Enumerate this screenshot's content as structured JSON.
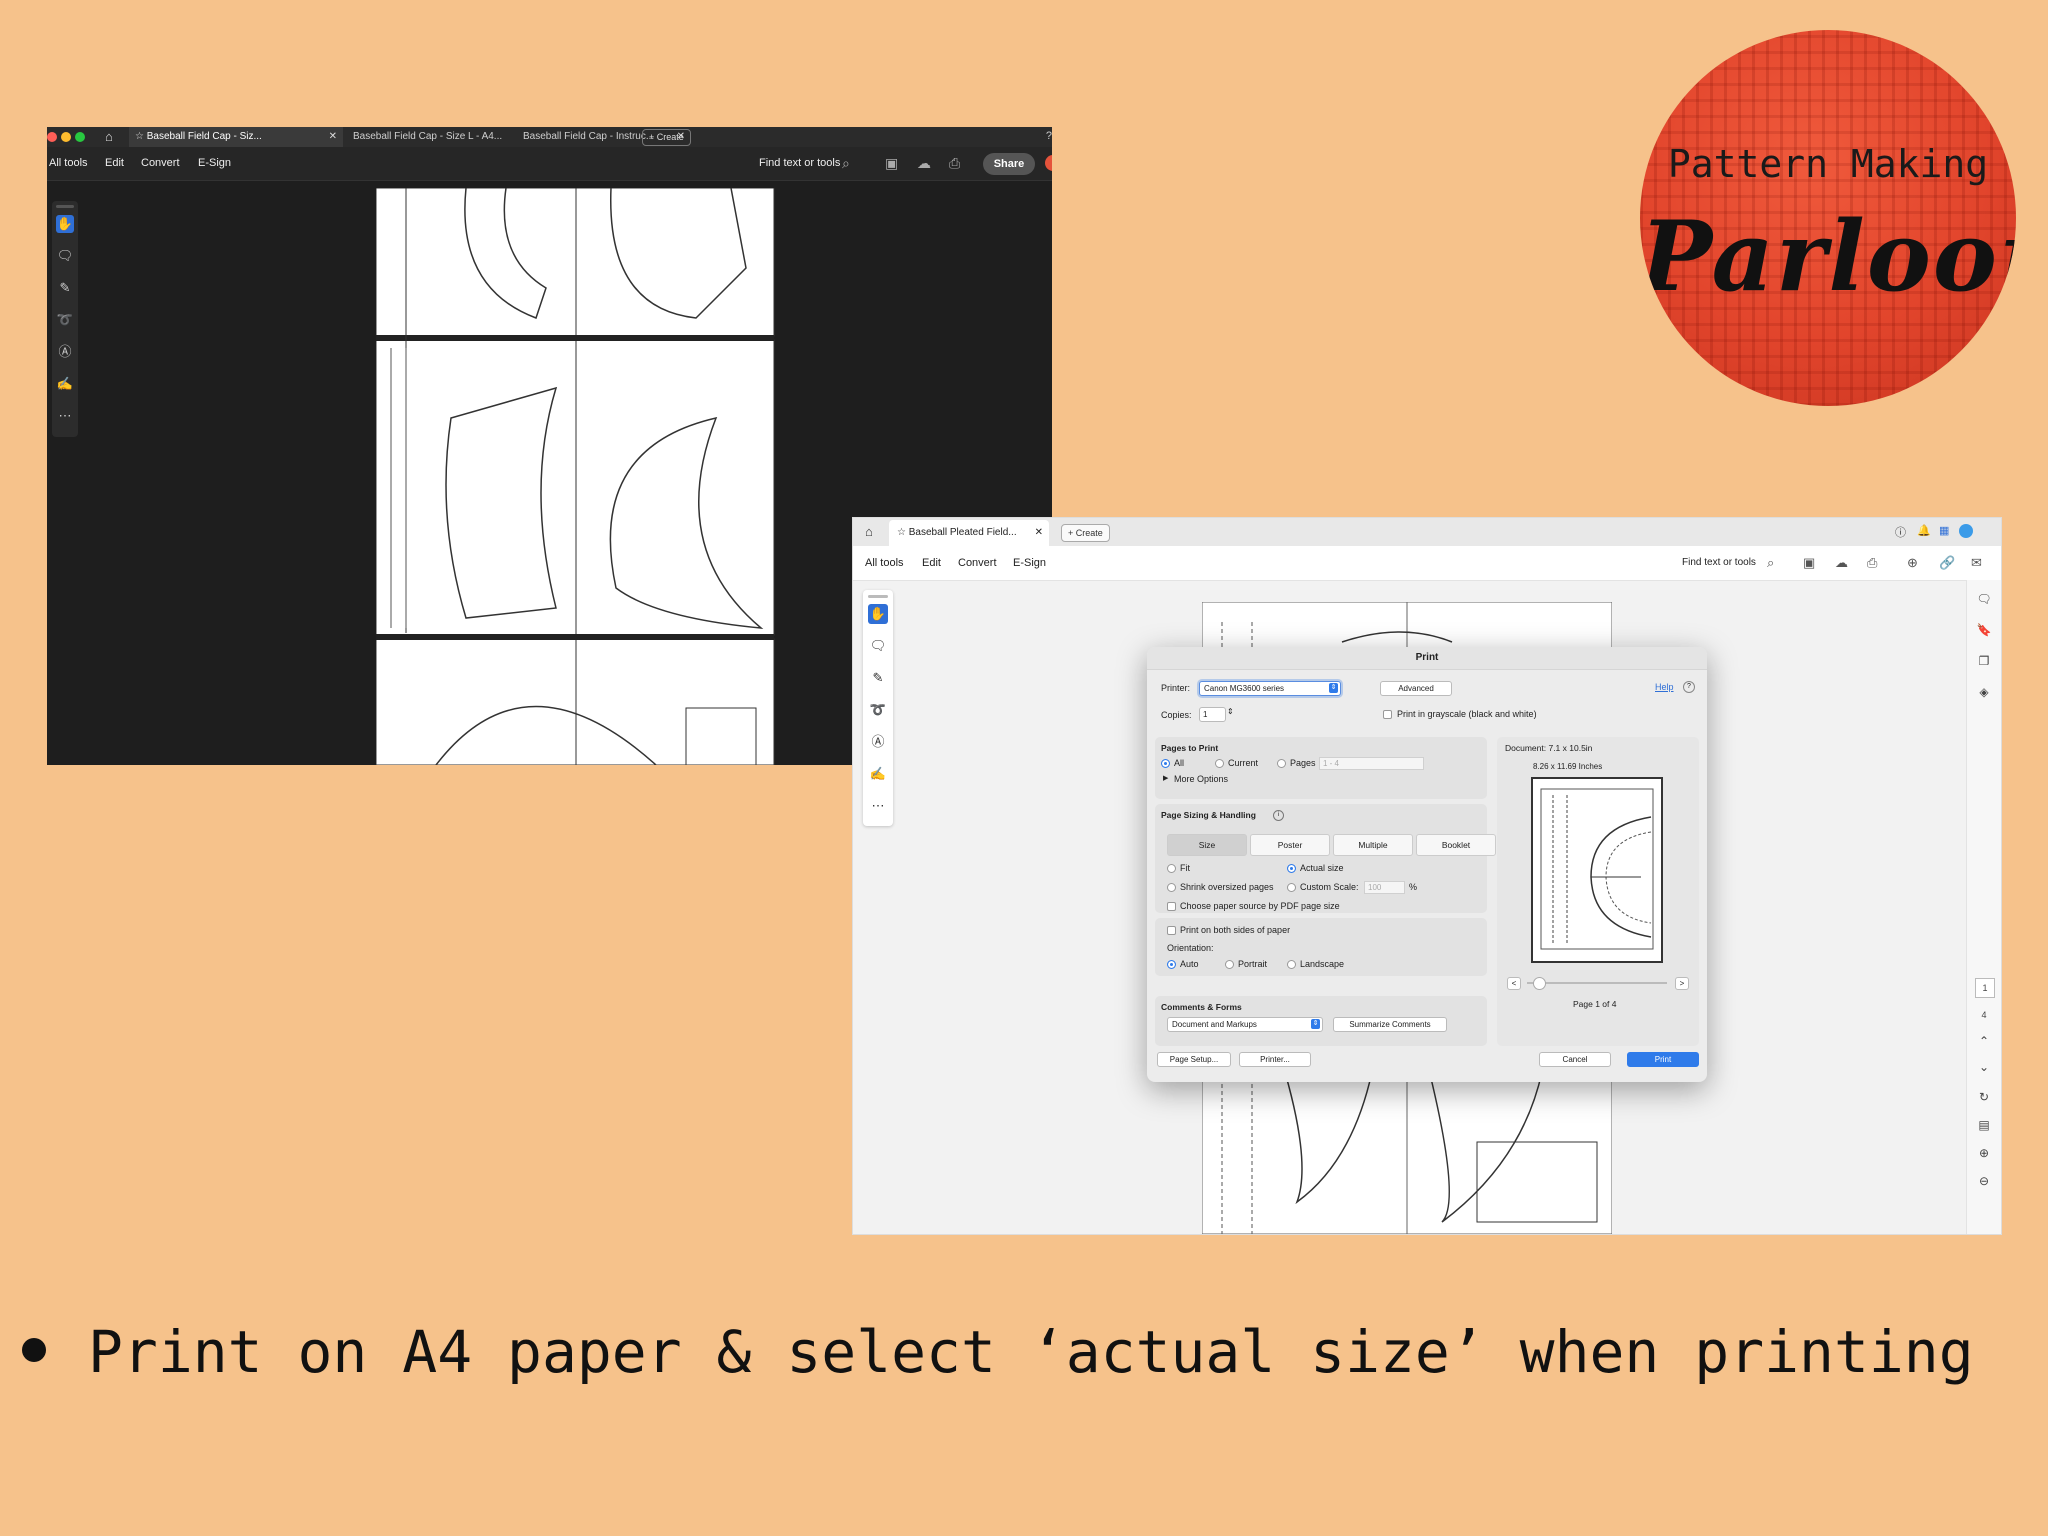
{
  "logo": {
    "line1": "Pattern Making",
    "line2": "Parloor"
  },
  "window_dark": {
    "tabs": [
      "Baseball Field Cap - Siz...",
      "Baseball Field Cap - Size L - A4...",
      "Baseball Field Cap - Instruc..."
    ],
    "create_label": "+ Create",
    "menu": [
      "All tools",
      "Edit",
      "Convert",
      "E-Sign"
    ],
    "find_label": "Find text or tools",
    "share_label": "Share"
  },
  "window_light": {
    "tab": "Baseball Pleated Field...",
    "create_label": "+ Create",
    "menu": [
      "All tools",
      "Edit",
      "Convert",
      "E-Sign"
    ],
    "find_label": "Find text or tools",
    "page_current": "1",
    "page_total": "4"
  },
  "print_dialog": {
    "title": "Print",
    "printer_label": "Printer:",
    "printer_value": "Canon MG3600 series",
    "advanced_label": "Advanced",
    "help_label": "Help",
    "copies_label": "Copies:",
    "copies_value": "1",
    "grayscale_label": "Print in grayscale (black and white)",
    "pages_to_print": {
      "heading": "Pages to Print",
      "all": "All",
      "current": "Current",
      "pages": "Pages",
      "pages_placeholder": "1 - 4",
      "more_options": "More Options"
    },
    "sizing": {
      "heading": "Page Sizing & Handling",
      "tabs": [
        "Size",
        "Poster",
        "Multiple",
        "Booklet"
      ],
      "fit": "Fit",
      "actual_size": "Actual size",
      "shrink": "Shrink oversized pages",
      "custom_scale": "Custom Scale:",
      "custom_scale_value": "100",
      "percent": "%",
      "paper_source": "Choose paper source by PDF page size"
    },
    "duplex_label": "Print on both sides of paper",
    "orientation": {
      "label": "Orientation:",
      "auto": "Auto",
      "portrait": "Portrait",
      "landscape": "Landscape"
    },
    "comments": {
      "heading": "Comments & Forms",
      "value": "Document and Markups",
      "summarize": "Summarize Comments"
    },
    "preview": {
      "document_size": "Document: 7.1 x 10.5in",
      "paper_size": "8.26 x 11.69 Inches",
      "page_of": "Page 1 of 4"
    },
    "buttons": {
      "page_setup": "Page Setup...",
      "printer": "Printer...",
      "cancel": "Cancel",
      "print": "Print"
    }
  },
  "caption": "Print on A4 paper & select ‘actual size’ when printing"
}
